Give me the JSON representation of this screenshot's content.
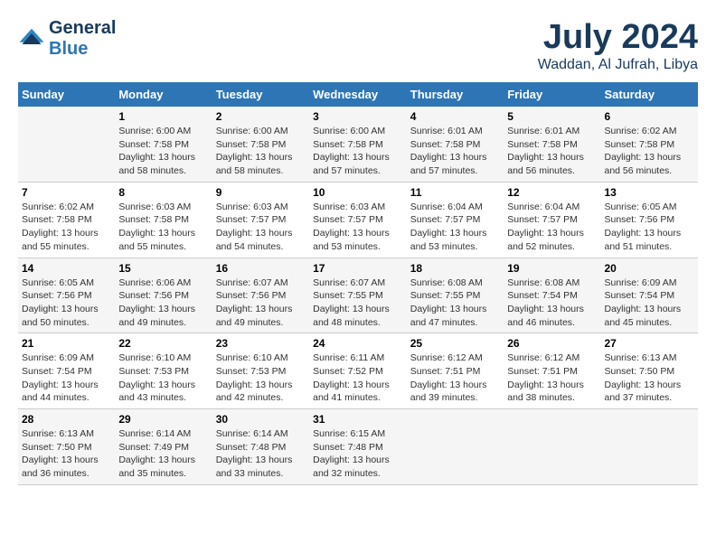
{
  "logo": {
    "line1": "General",
    "line2": "Blue"
  },
  "title": "July 2024",
  "subtitle": "Waddan, Al Jufrah, Libya",
  "days_of_week": [
    "Sunday",
    "Monday",
    "Tuesday",
    "Wednesday",
    "Thursday",
    "Friday",
    "Saturday"
  ],
  "weeks": [
    [
      {
        "day": "",
        "sunrise": "",
        "sunset": "",
        "daylight": ""
      },
      {
        "day": "1",
        "sunrise": "Sunrise: 6:00 AM",
        "sunset": "Sunset: 7:58 PM",
        "daylight": "Daylight: 13 hours and 58 minutes."
      },
      {
        "day": "2",
        "sunrise": "Sunrise: 6:00 AM",
        "sunset": "Sunset: 7:58 PM",
        "daylight": "Daylight: 13 hours and 58 minutes."
      },
      {
        "day": "3",
        "sunrise": "Sunrise: 6:00 AM",
        "sunset": "Sunset: 7:58 PM",
        "daylight": "Daylight: 13 hours and 57 minutes."
      },
      {
        "day": "4",
        "sunrise": "Sunrise: 6:01 AM",
        "sunset": "Sunset: 7:58 PM",
        "daylight": "Daylight: 13 hours and 57 minutes."
      },
      {
        "day": "5",
        "sunrise": "Sunrise: 6:01 AM",
        "sunset": "Sunset: 7:58 PM",
        "daylight": "Daylight: 13 hours and 56 minutes."
      },
      {
        "day": "6",
        "sunrise": "Sunrise: 6:02 AM",
        "sunset": "Sunset: 7:58 PM",
        "daylight": "Daylight: 13 hours and 56 minutes."
      }
    ],
    [
      {
        "day": "7",
        "sunrise": "Sunrise: 6:02 AM",
        "sunset": "Sunset: 7:58 PM",
        "daylight": "Daylight: 13 hours and 55 minutes."
      },
      {
        "day": "8",
        "sunrise": "Sunrise: 6:03 AM",
        "sunset": "Sunset: 7:58 PM",
        "daylight": "Daylight: 13 hours and 55 minutes."
      },
      {
        "day": "9",
        "sunrise": "Sunrise: 6:03 AM",
        "sunset": "Sunset: 7:57 PM",
        "daylight": "Daylight: 13 hours and 54 minutes."
      },
      {
        "day": "10",
        "sunrise": "Sunrise: 6:03 AM",
        "sunset": "Sunset: 7:57 PM",
        "daylight": "Daylight: 13 hours and 53 minutes."
      },
      {
        "day": "11",
        "sunrise": "Sunrise: 6:04 AM",
        "sunset": "Sunset: 7:57 PM",
        "daylight": "Daylight: 13 hours and 53 minutes."
      },
      {
        "day": "12",
        "sunrise": "Sunrise: 6:04 AM",
        "sunset": "Sunset: 7:57 PM",
        "daylight": "Daylight: 13 hours and 52 minutes."
      },
      {
        "day": "13",
        "sunrise": "Sunrise: 6:05 AM",
        "sunset": "Sunset: 7:56 PM",
        "daylight": "Daylight: 13 hours and 51 minutes."
      }
    ],
    [
      {
        "day": "14",
        "sunrise": "Sunrise: 6:05 AM",
        "sunset": "Sunset: 7:56 PM",
        "daylight": "Daylight: 13 hours and 50 minutes."
      },
      {
        "day": "15",
        "sunrise": "Sunrise: 6:06 AM",
        "sunset": "Sunset: 7:56 PM",
        "daylight": "Daylight: 13 hours and 49 minutes."
      },
      {
        "day": "16",
        "sunrise": "Sunrise: 6:07 AM",
        "sunset": "Sunset: 7:56 PM",
        "daylight": "Daylight: 13 hours and 49 minutes."
      },
      {
        "day": "17",
        "sunrise": "Sunrise: 6:07 AM",
        "sunset": "Sunset: 7:55 PM",
        "daylight": "Daylight: 13 hours and 48 minutes."
      },
      {
        "day": "18",
        "sunrise": "Sunrise: 6:08 AM",
        "sunset": "Sunset: 7:55 PM",
        "daylight": "Daylight: 13 hours and 47 minutes."
      },
      {
        "day": "19",
        "sunrise": "Sunrise: 6:08 AM",
        "sunset": "Sunset: 7:54 PM",
        "daylight": "Daylight: 13 hours and 46 minutes."
      },
      {
        "day": "20",
        "sunrise": "Sunrise: 6:09 AM",
        "sunset": "Sunset: 7:54 PM",
        "daylight": "Daylight: 13 hours and 45 minutes."
      }
    ],
    [
      {
        "day": "21",
        "sunrise": "Sunrise: 6:09 AM",
        "sunset": "Sunset: 7:54 PM",
        "daylight": "Daylight: 13 hours and 44 minutes."
      },
      {
        "day": "22",
        "sunrise": "Sunrise: 6:10 AM",
        "sunset": "Sunset: 7:53 PM",
        "daylight": "Daylight: 13 hours and 43 minutes."
      },
      {
        "day": "23",
        "sunrise": "Sunrise: 6:10 AM",
        "sunset": "Sunset: 7:53 PM",
        "daylight": "Daylight: 13 hours and 42 minutes."
      },
      {
        "day": "24",
        "sunrise": "Sunrise: 6:11 AM",
        "sunset": "Sunset: 7:52 PM",
        "daylight": "Daylight: 13 hours and 41 minutes."
      },
      {
        "day": "25",
        "sunrise": "Sunrise: 6:12 AM",
        "sunset": "Sunset: 7:51 PM",
        "daylight": "Daylight: 13 hours and 39 minutes."
      },
      {
        "day": "26",
        "sunrise": "Sunrise: 6:12 AM",
        "sunset": "Sunset: 7:51 PM",
        "daylight": "Daylight: 13 hours and 38 minutes."
      },
      {
        "day": "27",
        "sunrise": "Sunrise: 6:13 AM",
        "sunset": "Sunset: 7:50 PM",
        "daylight": "Daylight: 13 hours and 37 minutes."
      }
    ],
    [
      {
        "day": "28",
        "sunrise": "Sunrise: 6:13 AM",
        "sunset": "Sunset: 7:50 PM",
        "daylight": "Daylight: 13 hours and 36 minutes."
      },
      {
        "day": "29",
        "sunrise": "Sunrise: 6:14 AM",
        "sunset": "Sunset: 7:49 PM",
        "daylight": "Daylight: 13 hours and 35 minutes."
      },
      {
        "day": "30",
        "sunrise": "Sunrise: 6:14 AM",
        "sunset": "Sunset: 7:48 PM",
        "daylight": "Daylight: 13 hours and 33 minutes."
      },
      {
        "day": "31",
        "sunrise": "Sunrise: 6:15 AM",
        "sunset": "Sunset: 7:48 PM",
        "daylight": "Daylight: 13 hours and 32 minutes."
      },
      {
        "day": "",
        "sunrise": "",
        "sunset": "",
        "daylight": ""
      },
      {
        "day": "",
        "sunrise": "",
        "sunset": "",
        "daylight": ""
      },
      {
        "day": "",
        "sunrise": "",
        "sunset": "",
        "daylight": ""
      }
    ]
  ]
}
